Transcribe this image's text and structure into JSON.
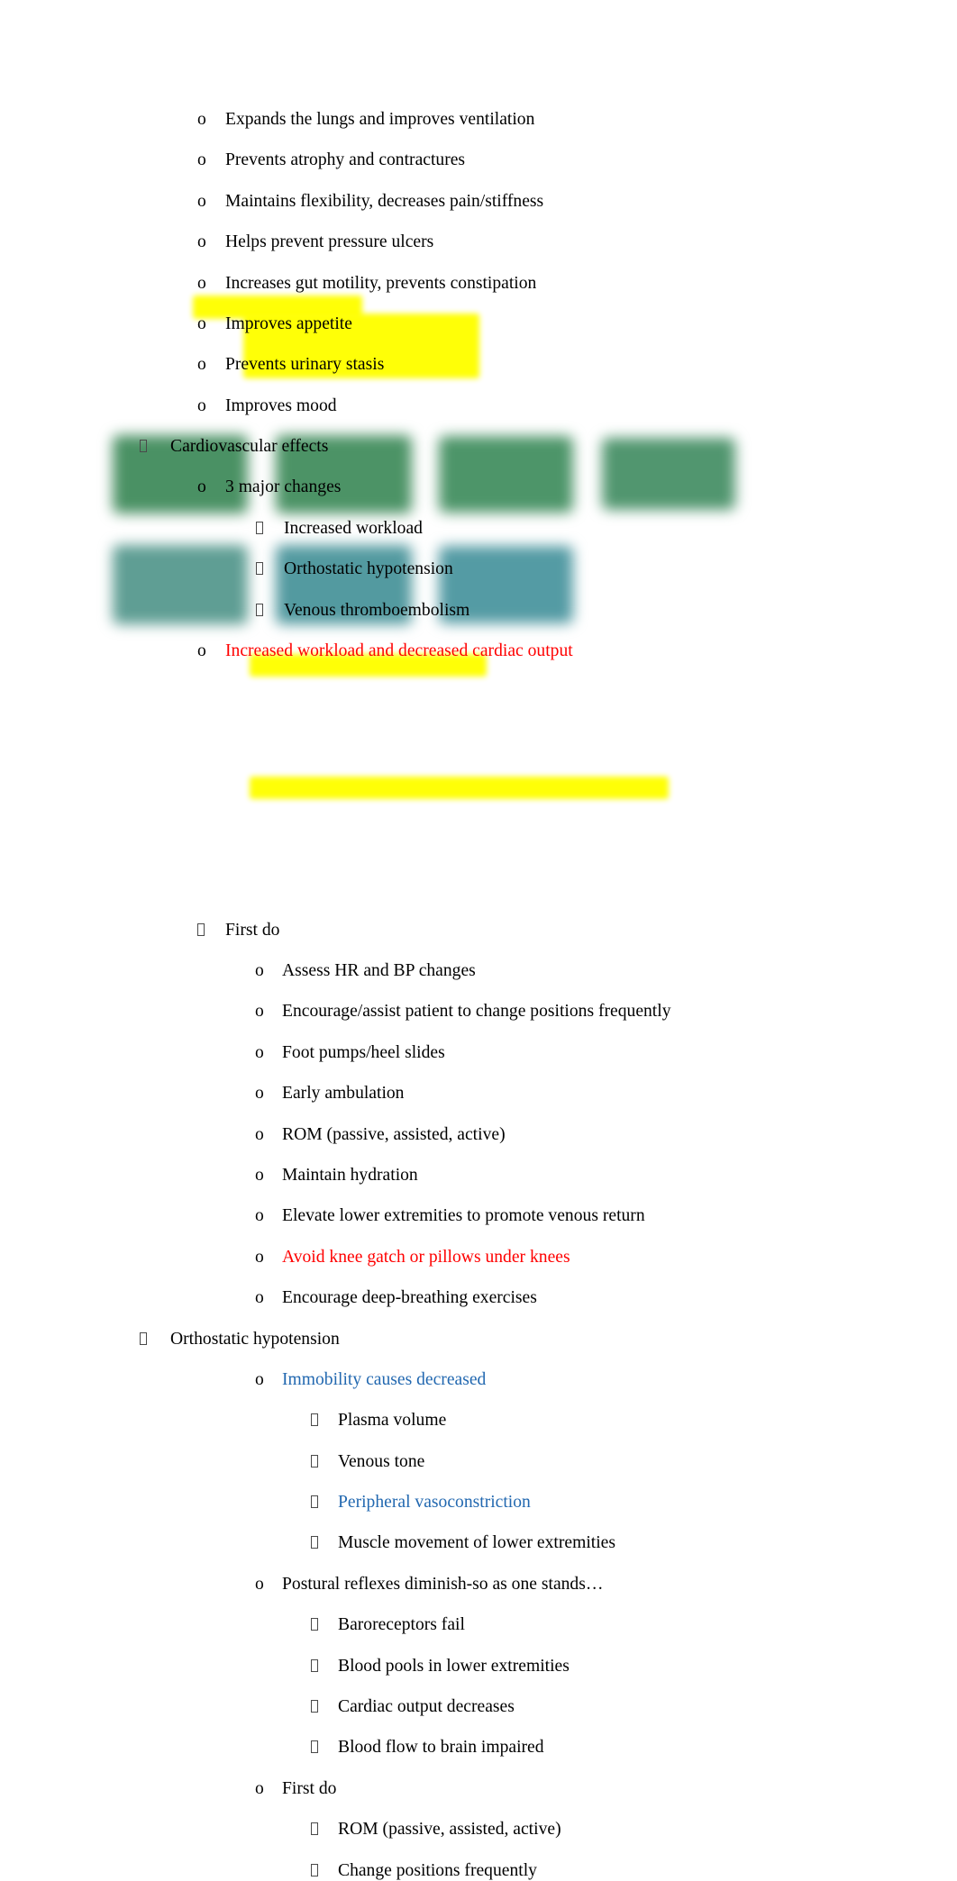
{
  "document": {
    "type": "lecture-notes",
    "topic": "Immobility — Cardiovascular effects",
    "colors": {
      "text": "#000000",
      "red_emphasis": "#ff0000",
      "blue_emphasis": "#2268b0",
      "highlight": "#ffff00",
      "image_green": "#4a9164",
      "image_green_alt": "#50966a",
      "image_teal": "#5f9e9c",
      "image_teal_alt": "#549a9e"
    },
    "bullet_glyphs": {
      "level1": "tofu-box",
      "level2": "o",
      "level3": "tofu-box"
    }
  },
  "content": {
    "benefits_list": [
      "Expands the lungs and improves ventilation",
      "Prevents atrophy and contractures",
      "Maintains flexibility, decreases pain/stiffness",
      "Helps prevent pressure ulcers",
      "Increases gut motility, prevents constipation",
      "Improves appetite",
      "Prevents urinary stasis",
      "Improves mood"
    ],
    "cardiovascular": {
      "heading": "Cardiovascular effects",
      "three_major_changes_label": "3 major changes",
      "three_major_changes": [
        "Increased workload",
        "Orthostatic hypotension",
        "Venous thromboembolism"
      ],
      "increased_workload_line": "Increased workload and decreased cardiac output"
    },
    "images": {
      "count": 7,
      "description": "blurred redacted image thumbnails",
      "row1": [
        {
          "name": "image-thumb-1",
          "color": "#4a9164"
        },
        {
          "name": "image-thumb-2",
          "color": "#4c9366"
        },
        {
          "name": "image-thumb-3",
          "color": "#4d9569"
        },
        {
          "name": "image-thumb-4",
          "color": "#51966f"
        }
      ],
      "row2": [
        {
          "name": "image-thumb-5",
          "color": "#5f9e94"
        },
        {
          "name": "image-thumb-6",
          "color": "#539aa0"
        },
        {
          "name": "image-thumb-7",
          "color": "#549ba4"
        }
      ]
    },
    "first_do_cardio": {
      "heading": "First do",
      "items": [
        "Assess HR and BP changes",
        "Encourage/assist patient to change positions frequently",
        "Foot pumps/heel slides",
        "Early ambulation",
        "ROM (passive, assisted, active)",
        "Maintain hydration",
        "Elevate lower extremities to promote venous return",
        "Avoid knee gatch or pillows under knees",
        "Encourage deep-breathing exercises"
      ]
    },
    "orthostatic": {
      "heading": "Orthostatic hypotension",
      "immobility_causes_label": "Immobility causes decreased",
      "immobility_causes": [
        "Plasma volume",
        "Venous tone",
        "Peripheral vasoconstriction",
        "Muscle movement of lower extremities"
      ],
      "postural_label": "Postural reflexes diminish-so as one stands…",
      "postural_items": [
        "Baroreceptors fail",
        "Blood pools in lower extremities",
        "Cardiac output decreases",
        "Blood flow to brain impaired"
      ],
      "first_do_label": "First do",
      "first_do_items": [
        "ROM (passive, assisted, active)",
        "Change positions frequently"
      ]
    }
  }
}
